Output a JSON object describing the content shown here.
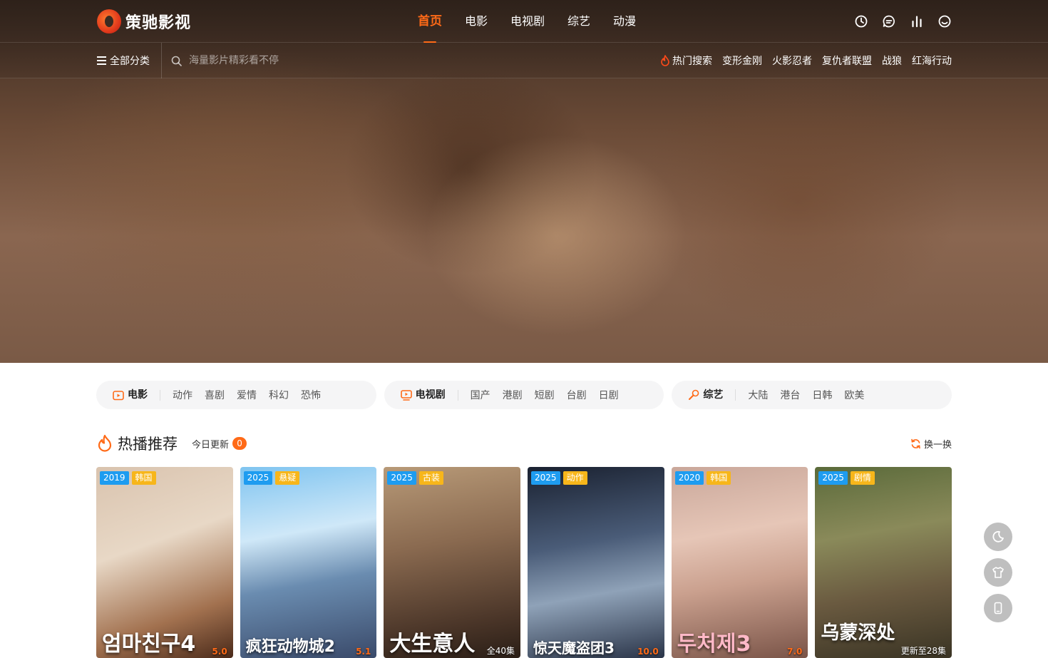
{
  "brand": {
    "name": "策驰影视"
  },
  "nav": {
    "items": [
      {
        "label": "首页",
        "active": true
      },
      {
        "label": "电影"
      },
      {
        "label": "电视剧"
      },
      {
        "label": "综艺"
      },
      {
        "label": "动漫"
      }
    ]
  },
  "top_icons": [
    "history-icon",
    "message-icon",
    "ranking-icon",
    "user-icon"
  ],
  "subbar": {
    "all_categories": "全部分类",
    "search_placeholder": "海量影片精彩看不停",
    "hot_title": "热门搜索",
    "hot_terms": [
      "变形金刚",
      "火影忍者",
      "复仇者联盟",
      "战狼",
      "红海行动"
    ]
  },
  "categories": [
    {
      "title": "电影",
      "icon": "movie-icon",
      "subs": [
        "动作",
        "喜剧",
        "爱情",
        "科幻",
        "恐怖"
      ]
    },
    {
      "title": "电视剧",
      "icon": "tv-icon",
      "subs": [
        "国产",
        "港剧",
        "短剧",
        "台剧",
        "日剧"
      ]
    },
    {
      "title": "综艺",
      "icon": "mic-icon",
      "subs": [
        "大陆",
        "港台",
        "日韩",
        "欧美"
      ]
    }
  ],
  "section": {
    "title": "热播推荐",
    "today_label": "今日更新",
    "today_count": "0",
    "refresh_label": "换一换"
  },
  "cards": [
    {
      "year": "2019",
      "genre": "韩国",
      "poster_text": "엄마친구4",
      "corner": "5.0",
      "corner_type": "score"
    },
    {
      "year": "2025",
      "genre": "悬疑",
      "poster_text": "疯狂动物城2",
      "corner": "5.1",
      "corner_type": "score"
    },
    {
      "year": "2025",
      "genre": "古装",
      "poster_text": "大生意人",
      "corner": "全40集",
      "corner_type": "episodes"
    },
    {
      "year": "2025",
      "genre": "动作",
      "poster_text": "惊天魔盗团3",
      "corner": "10.0",
      "corner_type": "score"
    },
    {
      "year": "2020",
      "genre": "韩国",
      "poster_text": "두처제3",
      "corner": "7.0",
      "corner_type": "score"
    },
    {
      "year": "2025",
      "genre": "剧情",
      "poster_text": "乌蒙深处",
      "corner": "更新至28集",
      "corner_type": "episodes"
    }
  ],
  "float_buttons": [
    "moon-icon",
    "shirt-icon",
    "phone-icon"
  ],
  "colors": {
    "accent": "#ff6a17",
    "year_tag": "#1e9cf0",
    "genre_tag": "#f7b61a"
  }
}
